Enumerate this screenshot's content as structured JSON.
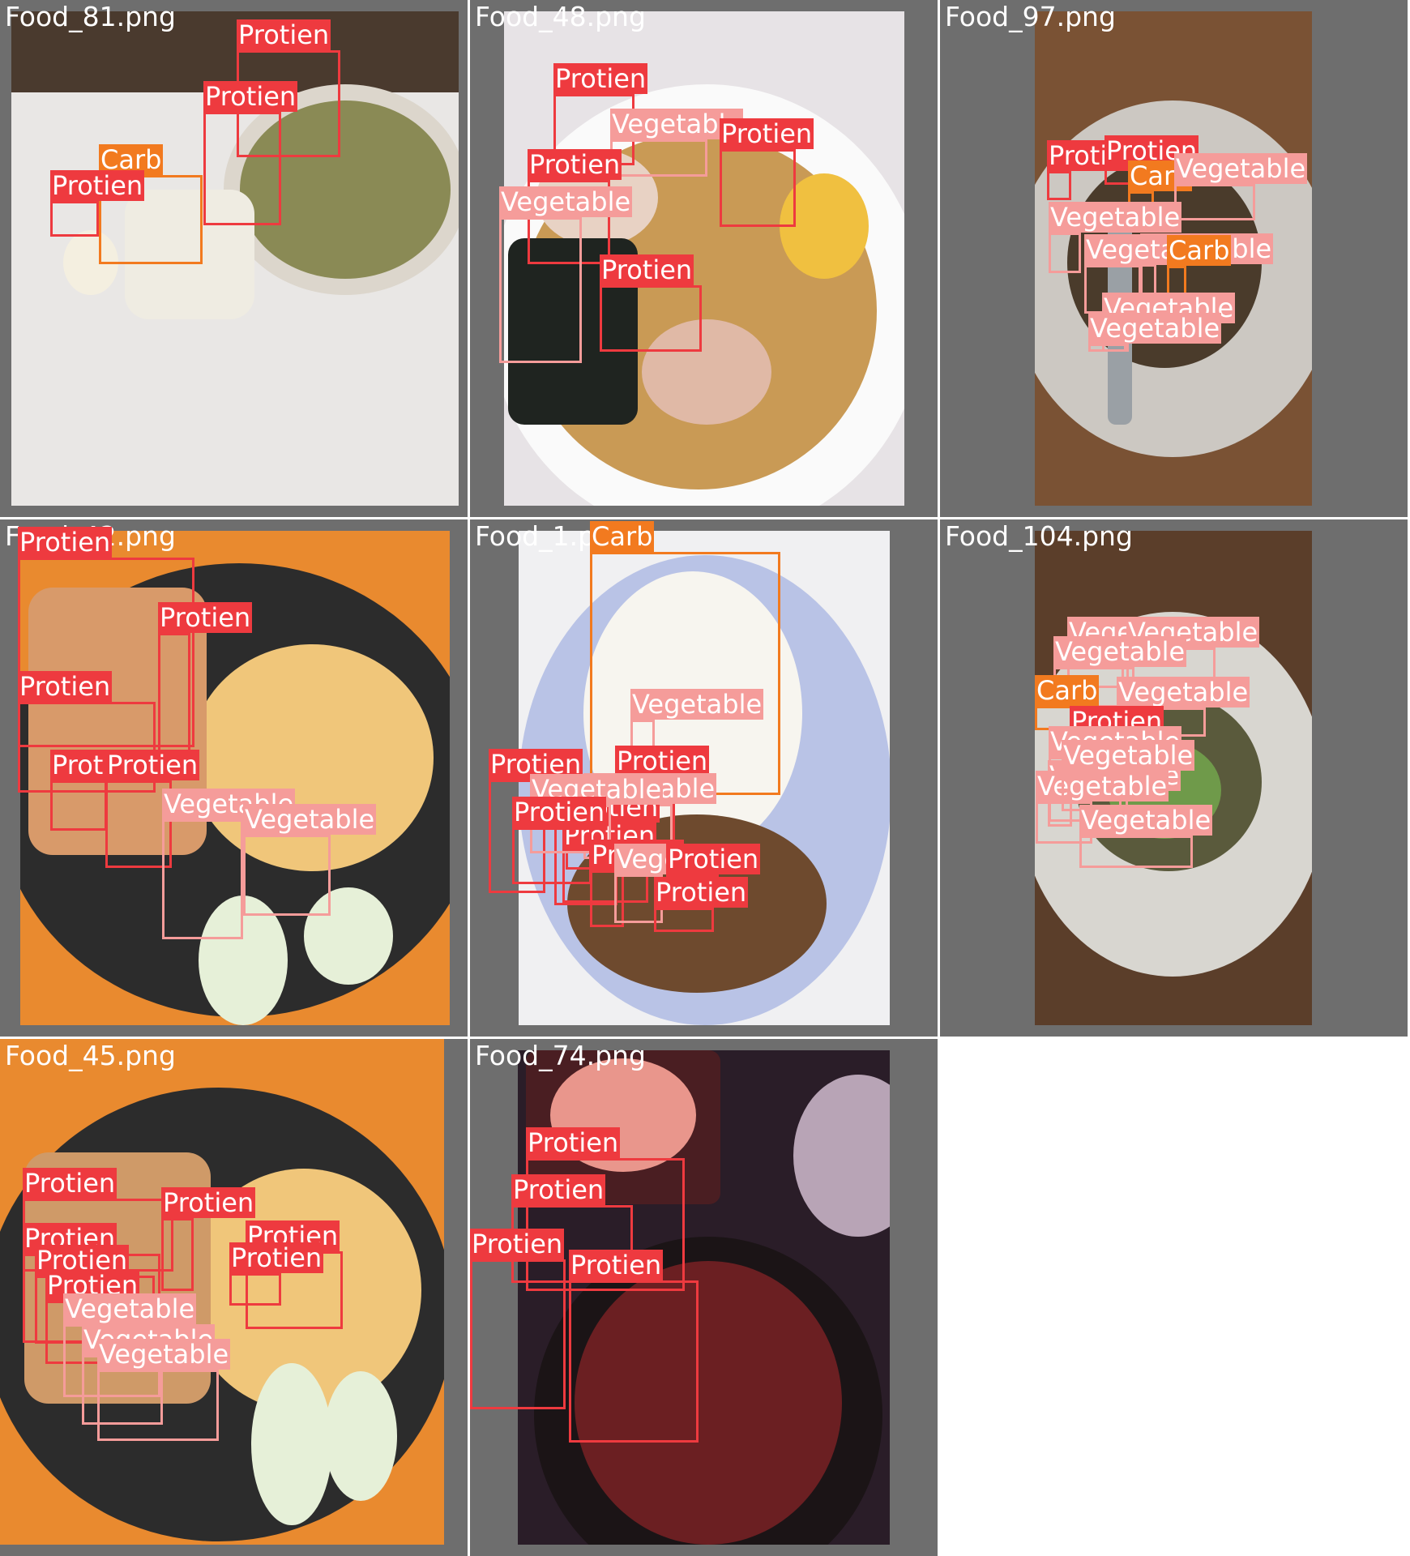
{
  "colors": {
    "Protien": "#ee3a3f",
    "Carb": "#f27a1f",
    "Vegetable": "#f59c9a",
    "background": "#6e6e6e"
  },
  "tiles": [
    {
      "filename": "Food_81.png",
      "detections": [
        {
          "cls": "Protien"
        },
        {
          "cls": "Protien"
        },
        {
          "cls": "Carb"
        },
        {
          "cls": "Protien"
        }
      ]
    },
    {
      "filename": "Food_48.png",
      "detections": [
        {
          "cls": "Protien"
        },
        {
          "cls": "Vegetable"
        },
        {
          "cls": "Protien"
        },
        {
          "cls": "Protien"
        },
        {
          "cls": "Vegetable"
        },
        {
          "cls": "Protien"
        }
      ]
    },
    {
      "filename": "Food_97.png",
      "detections": [
        {
          "cls": "Protien"
        },
        {
          "cls": "Protien"
        },
        {
          "cls": "Carb"
        },
        {
          "cls": "Vegetable"
        },
        {
          "cls": "Vegetable"
        },
        {
          "cls": "Vegetable"
        },
        {
          "cls": "Vegetable"
        },
        {
          "cls": "Carb"
        },
        {
          "cls": "Vegetable"
        },
        {
          "cls": "Vegetable"
        }
      ]
    },
    {
      "filename": "Food_42.png",
      "detections": [
        {
          "cls": "Protien"
        },
        {
          "cls": "Protien"
        },
        {
          "cls": "Protien"
        },
        {
          "cls": "Protien"
        },
        {
          "cls": "Protien"
        },
        {
          "cls": "Vegetable"
        },
        {
          "cls": "Vegetable"
        }
      ]
    },
    {
      "filename": "Food_1.png",
      "detections": [
        {
          "cls": "Carb"
        },
        {
          "cls": "Vegetable"
        },
        {
          "cls": "Protien"
        },
        {
          "cls": "Protien"
        },
        {
          "cls": "Protien"
        },
        {
          "cls": "Vegetable"
        },
        {
          "cls": "Protien"
        },
        {
          "cls": "Protien"
        },
        {
          "cls": "Vegetable"
        },
        {
          "cls": "Protien"
        },
        {
          "cls": "Protien"
        },
        {
          "cls": "Vegetable"
        },
        {
          "cls": "Protien"
        },
        {
          "cls": "Protien"
        }
      ]
    },
    {
      "filename": "Food_104.png",
      "detections": [
        {
          "cls": "Vegetable"
        },
        {
          "cls": "Vegetable"
        },
        {
          "cls": "Vegetable"
        },
        {
          "cls": "Carb"
        },
        {
          "cls": "Vegetable"
        },
        {
          "cls": "Protien"
        },
        {
          "cls": "Vegetable"
        },
        {
          "cls": "Vegetable"
        },
        {
          "cls": "Vegetable"
        },
        {
          "cls": "Vegetable"
        },
        {
          "cls": "Vegetable"
        }
      ]
    },
    {
      "filename": "Food_45.png",
      "detections": [
        {
          "cls": "Protien"
        },
        {
          "cls": "Protien"
        },
        {
          "cls": "Protien"
        },
        {
          "cls": "Protien"
        },
        {
          "cls": "Protien"
        },
        {
          "cls": "Protien"
        },
        {
          "cls": "Protien"
        },
        {
          "cls": "Vegetable"
        },
        {
          "cls": "Vegetable"
        },
        {
          "cls": "Vegetable"
        }
      ]
    },
    {
      "filename": "Food_74.png",
      "detections": [
        {
          "cls": "Protien"
        },
        {
          "cls": "Protien"
        },
        {
          "cls": "Protien"
        },
        {
          "cls": "Protien"
        }
      ]
    }
  ]
}
